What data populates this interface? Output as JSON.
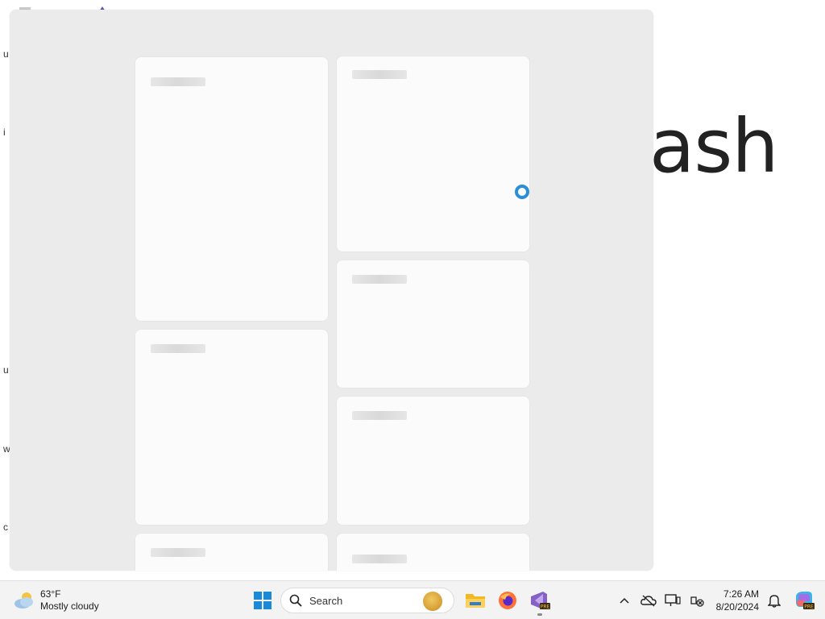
{
  "desktop": {
    "background_word": "ash",
    "left_edge_letters": [
      "u",
      "i",
      "u",
      "w",
      "c"
    ]
  },
  "widgets": {
    "loading_cards": 8,
    "spinner_color": "#2b8fd8"
  },
  "taskbar": {
    "weather": {
      "temperature": "63°F",
      "condition": "Mostly cloudy",
      "icon": "partly-cloudy-icon"
    },
    "start_icon": "windows-start-icon",
    "search": {
      "label": "Search",
      "icon": "search-icon"
    },
    "pinned_apps": [
      {
        "name": "File Explorer",
        "icon": "file-explorer-icon"
      },
      {
        "name": "Firefox",
        "icon": "firefox-icon"
      },
      {
        "name": "Visual Studio Preview",
        "icon": "visual-studio-preview-icon",
        "badge": "PRE"
      }
    ],
    "tray": {
      "overflow_icon": "chevron-up-icon",
      "icons": [
        "onedrive-offline-icon",
        "display-settings-icon",
        "network-icon"
      ],
      "time": "7:26 AM",
      "date": "8/20/2024",
      "notification_icon": "bell-icon",
      "copilot_badge": "PRE"
    }
  }
}
